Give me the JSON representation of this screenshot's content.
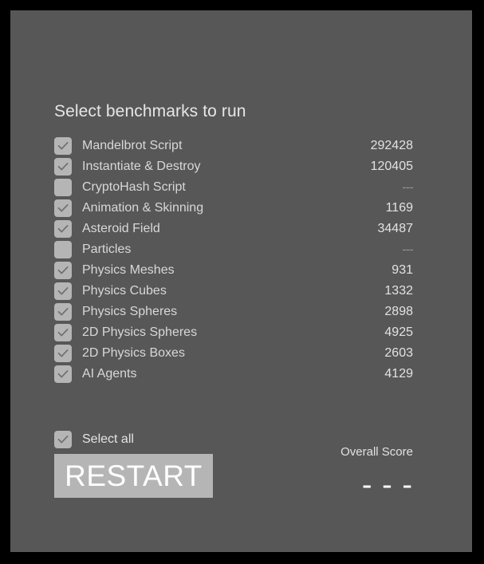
{
  "panel": {
    "title": "Select benchmarks to run",
    "background_color": "#575757",
    "frame_color": "#000000",
    "control_color": "#b5b5b5"
  },
  "benchmarks": [
    {
      "label": "Mandelbrot Script",
      "checked": true,
      "score": "292428",
      "has_score": true,
      "checkbox_name": "checkbox-mandelbrot-script"
    },
    {
      "label": "Instantiate & Destroy",
      "checked": true,
      "score": "120405",
      "has_score": true,
      "checkbox_name": "checkbox-instantiate-destroy"
    },
    {
      "label": "CryptoHash Script",
      "checked": false,
      "score": "---",
      "has_score": false,
      "checkbox_name": "checkbox-cryptohash-script"
    },
    {
      "label": "Animation & Skinning",
      "checked": true,
      "score": "1169",
      "has_score": true,
      "checkbox_name": "checkbox-animation-skinning"
    },
    {
      "label": "Asteroid Field",
      "checked": true,
      "score": "34487",
      "has_score": true,
      "checkbox_name": "checkbox-asteroid-field"
    },
    {
      "label": "Particles",
      "checked": false,
      "score": "---",
      "has_score": false,
      "checkbox_name": "checkbox-particles"
    },
    {
      "label": "Physics Meshes",
      "checked": true,
      "score": "931",
      "has_score": true,
      "checkbox_name": "checkbox-physics-meshes"
    },
    {
      "label": "Physics Cubes",
      "checked": true,
      "score": "1332",
      "has_score": true,
      "checkbox_name": "checkbox-physics-cubes"
    },
    {
      "label": "Physics Spheres",
      "checked": true,
      "score": "2898",
      "has_score": true,
      "checkbox_name": "checkbox-physics-spheres"
    },
    {
      "label": "2D Physics Spheres",
      "checked": true,
      "score": "4925",
      "has_score": true,
      "checkbox_name": "checkbox-2d-physics-spheres"
    },
    {
      "label": "2D Physics Boxes",
      "checked": true,
      "score": "2603",
      "has_score": true,
      "checkbox_name": "checkbox-2d-physics-boxes"
    },
    {
      "label": "AI Agents",
      "checked": true,
      "score": "4129",
      "has_score": true,
      "checkbox_name": "checkbox-ai-agents"
    }
  ],
  "select_all": {
    "label": "Select all",
    "checked": true
  },
  "overall_score": {
    "label": "Overall Score",
    "value": "- - -"
  },
  "restart": {
    "label": "RESTART"
  }
}
